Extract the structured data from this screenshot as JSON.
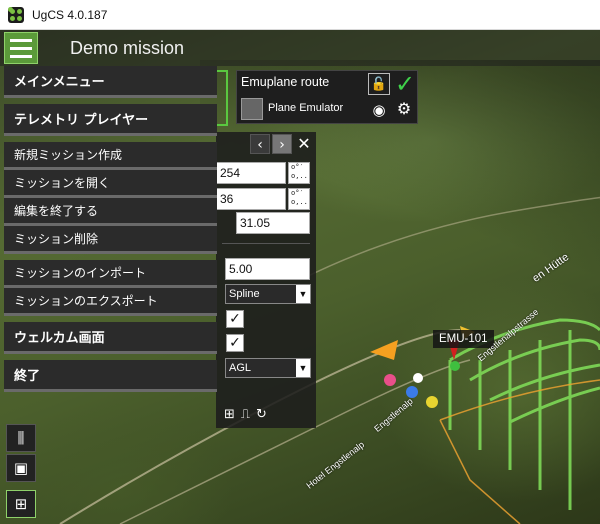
{
  "window": {
    "title": "UgCS 4.0.187"
  },
  "header": {
    "mission_title": "Demo mission"
  },
  "main_menu": {
    "items": [
      {
        "label": "メインメニュー",
        "style": "big"
      },
      {
        "label": "テレメトリ プレイヤー",
        "style": "big"
      },
      {
        "label": "新規ミッション作成",
        "style": "small"
      },
      {
        "label": "ミッションを開く",
        "style": "small"
      },
      {
        "label": "編集を終了する",
        "style": "small"
      },
      {
        "label": "ミッション削除",
        "style": "small"
      },
      {
        "label": "ミッションのインポート",
        "style": "small"
      },
      {
        "label": "ミッションのエクスポート",
        "style": "small"
      },
      {
        "label": "ウェルカム画面",
        "style": "big"
      },
      {
        "label": "終了",
        "style": "big"
      }
    ]
  },
  "route_panel": {
    "route_name": "Emuplane route",
    "vehicle_name": "Plane Emulator"
  },
  "segment_panel": {
    "field_lat": "254",
    "field_lon": "36",
    "field_alt": "31.05",
    "field_speed": "5.00",
    "turn_type": "Spline",
    "altitude_type": "AGL",
    "checkbox_1": "✓",
    "checkbox_2": "✓"
  },
  "map": {
    "vehicle_label": "EMU-101",
    "road_labels": [
      "Hotel Engstlenalp",
      "Engstlenalp",
      "Engstlenalpstrasse",
      "en Hütte"
    ]
  },
  "colors": {
    "accent_green": "#5b9a3a",
    "check_green": "#3fd14a",
    "route_green": "#7ed957",
    "route_orange": "#e8a030"
  },
  "icons": [
    "menu-icon",
    "lock-icon",
    "check-icon",
    "eye-icon",
    "gear-icon",
    "chevron-left-icon",
    "chevron-right-icon",
    "close-icon",
    "undo-icon",
    "tools-icon",
    "layers-icon",
    "zoom-icon"
  ]
}
